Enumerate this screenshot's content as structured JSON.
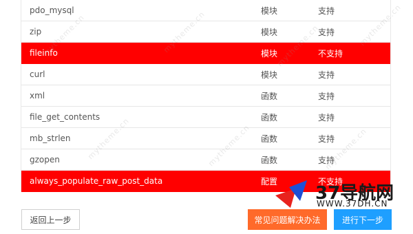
{
  "rows": [
    {
      "name": "pdo_mysql",
      "type": "模块",
      "status": "支持",
      "ok": true
    },
    {
      "name": "zip",
      "type": "模块",
      "status": "支持",
      "ok": true
    },
    {
      "name": "fileinfo",
      "type": "模块",
      "status": "不支持",
      "ok": false
    },
    {
      "name": "curl",
      "type": "模块",
      "status": "支持",
      "ok": true
    },
    {
      "name": "xml",
      "type": "函数",
      "status": "支持",
      "ok": true
    },
    {
      "name": "file_get_contents",
      "type": "函数",
      "status": "支持",
      "ok": true
    },
    {
      "name": "mb_strlen",
      "type": "函数",
      "status": "支持",
      "ok": true
    },
    {
      "name": "gzopen",
      "type": "函数",
      "status": "支持",
      "ok": true
    },
    {
      "name": "always_populate_raw_post_data",
      "type": "配置",
      "status": "不支持",
      "ok": false
    }
  ],
  "buttons": {
    "back": "返回上一步",
    "faq": "常见问题解决办法",
    "next": "进行下一步"
  },
  "watermark": "mytheme.cn",
  "logo": {
    "text": "37导航网",
    "url": "WWW.37DH.CN"
  },
  "colors": {
    "fail_row": "#ff0000",
    "faq_button": "#ff6a2a",
    "next_button": "#1e9fff"
  }
}
